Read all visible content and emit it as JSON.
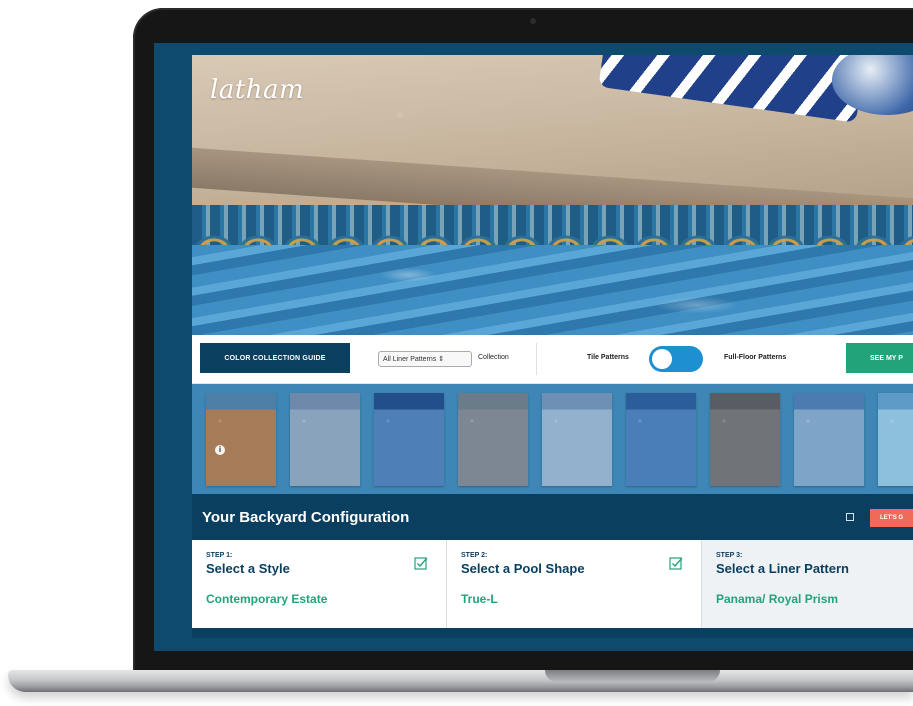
{
  "brand": {
    "logo_text": "latham"
  },
  "controls": {
    "guide_button": "COLOR COLLECTION GUIDE",
    "pattern_select": "All Liner Patterns ⇕",
    "collection_label": "Collection",
    "tile_patterns_label": "Tile Patterns",
    "full_floor_label": "Full-Floor Patterns",
    "see_button": "SEE MY P"
  },
  "swatches": [
    {
      "colors": [
        "#4d7fa7",
        "#a67b58"
      ],
      "info": "i"
    },
    {
      "colors": [
        "#6d88a8",
        "#8aa3bd"
      ]
    },
    {
      "colors": [
        "#224e8b",
        "#4e7fb6"
      ]
    },
    {
      "colors": [
        "#6a7b8a",
        "#7c8793"
      ]
    },
    {
      "colors": [
        "#6e90b5",
        "#93b1cc"
      ]
    },
    {
      "colors": [
        "#2a5d99",
        "#4a7eb8"
      ]
    },
    {
      "colors": [
        "#5a5c63",
        "#707378"
      ]
    },
    {
      "colors": [
        "#4b7bb0",
        "#7ea4c8"
      ]
    },
    {
      "colors": [
        "#5d9ac5",
        "#8cc0dc"
      ]
    }
  ],
  "configuration": {
    "title": "Your Backyard Configuration",
    "action_button": "LET'S G",
    "steps": [
      {
        "num": "STEP 1:",
        "title": "Select a Style",
        "value": "Contemporary Estate",
        "done": true
      },
      {
        "num": "STEP 2:",
        "title": "Select a Pool Shape",
        "value": "True-L",
        "done": true
      },
      {
        "num": "STEP 3:",
        "title": "Select a Liner Pattern",
        "value": "Panama/ Royal Prism",
        "done": false
      }
    ]
  },
  "accent_colors": {
    "navy": "#0b3f60",
    "green": "#22a37a",
    "toggle": "#1e8fd0",
    "coral": "#f06a5a"
  }
}
